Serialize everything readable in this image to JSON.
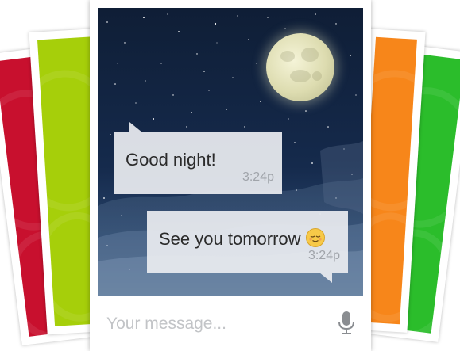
{
  "background_cards": [
    {
      "name": "red",
      "color": "#c8102e"
    },
    {
      "name": "yellowgreen",
      "color": "#a6cf0a"
    },
    {
      "name": "orange",
      "color": "#f7861a"
    },
    {
      "name": "green",
      "color": "#2bbd2b"
    }
  ],
  "chat": {
    "messages": [
      {
        "direction": "incoming",
        "text": "Good night!",
        "time": "3:24p"
      },
      {
        "direction": "outgoing",
        "text": "See you tomorrow",
        "emoji": "relieved-face-icon",
        "time": "3:24p"
      }
    ]
  },
  "input": {
    "placeholder": "Your message...",
    "icon": "microphone-icon"
  }
}
